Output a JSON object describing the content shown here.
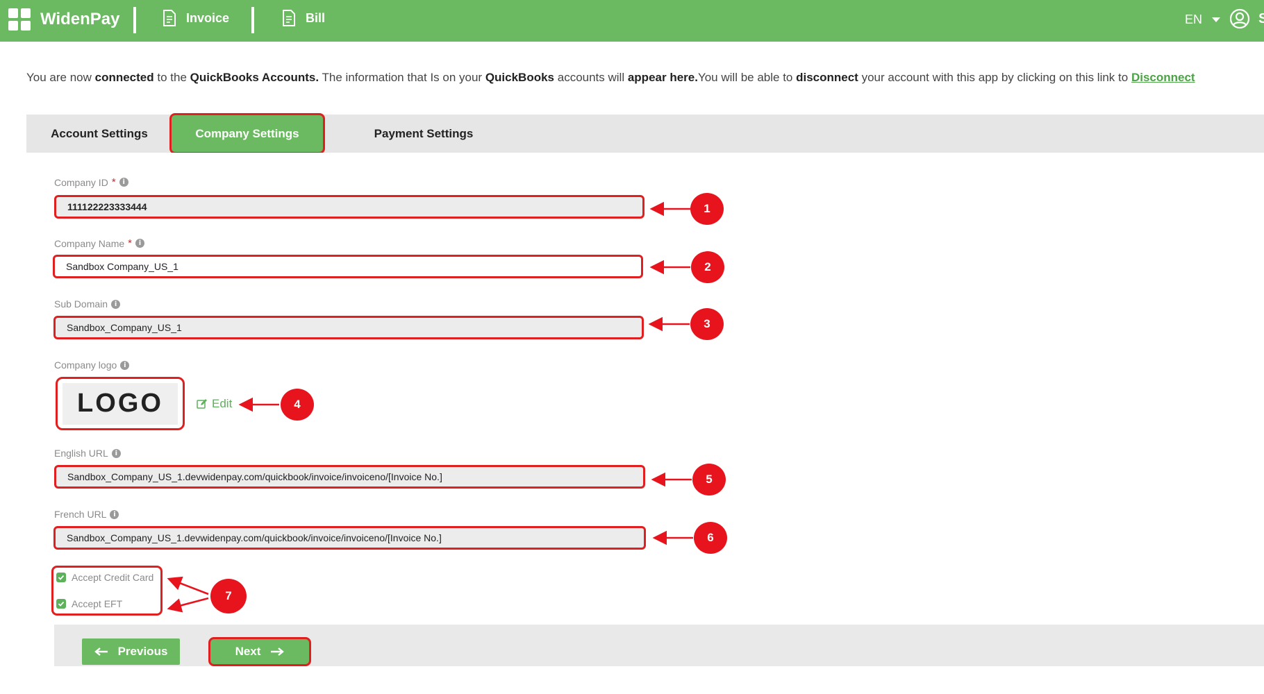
{
  "header": {
    "brand": "WidenPay",
    "nav": [
      {
        "label": "Invoice",
        "icon": "invoice-document-icon"
      },
      {
        "label": "Bill",
        "icon": "bill-document-icon"
      }
    ],
    "language": "EN",
    "user_initial": "S"
  },
  "info": {
    "t1": "You are now ",
    "b1": "connected",
    "t2": " to the ",
    "b2": "QuickBooks Accounts.",
    "t3": " The information that Is on your ",
    "b3": "QuickBooks",
    "t4": " accounts will ",
    "b4": "appear here.",
    "t5": "You will be able to ",
    "b5": "disconnect",
    "t6": " your account with this app by clicking on this link to ",
    "link": "Disconnect"
  },
  "tabs": [
    {
      "label": "Account Settings",
      "active": false
    },
    {
      "label": "Company Settings",
      "active": true
    },
    {
      "label": "Payment Settings",
      "active": false
    }
  ],
  "form": {
    "company_id": {
      "label": "Company ID",
      "required": "*",
      "value": "111122223333444"
    },
    "company_name": {
      "label": "Company Name",
      "required": "*",
      "value": "Sandbox Company_US_1"
    },
    "sub_domain": {
      "label": "Sub Domain",
      "value": "Sandbox_Company_US_1"
    },
    "company_logo": {
      "label": "Company logo",
      "logo_text": "LOGO",
      "edit_label": "Edit"
    },
    "english_url": {
      "label": "English URL",
      "value": "Sandbox_Company_US_1.devwidenpay.com/quickbook/invoice/invoiceno/[Invoice No.]"
    },
    "french_url": {
      "label": "French URL",
      "value": "Sandbox_Company_US_1.devwidenpay.com/quickbook/invoice/invoiceno/[Invoice No.]"
    },
    "accept_credit_card": {
      "label": "Accept Credit Card",
      "checked": true
    },
    "accept_eft": {
      "label": "Accept EFT",
      "checked": true
    }
  },
  "buttons": {
    "previous": "Previous",
    "next": "Next"
  },
  "annotations": [
    "1",
    "2",
    "3",
    "4",
    "5",
    "6",
    "7"
  ],
  "colors": {
    "brand_green": "#6bb961",
    "highlight_red": "#e02020",
    "badge_red": "#e8141d"
  }
}
